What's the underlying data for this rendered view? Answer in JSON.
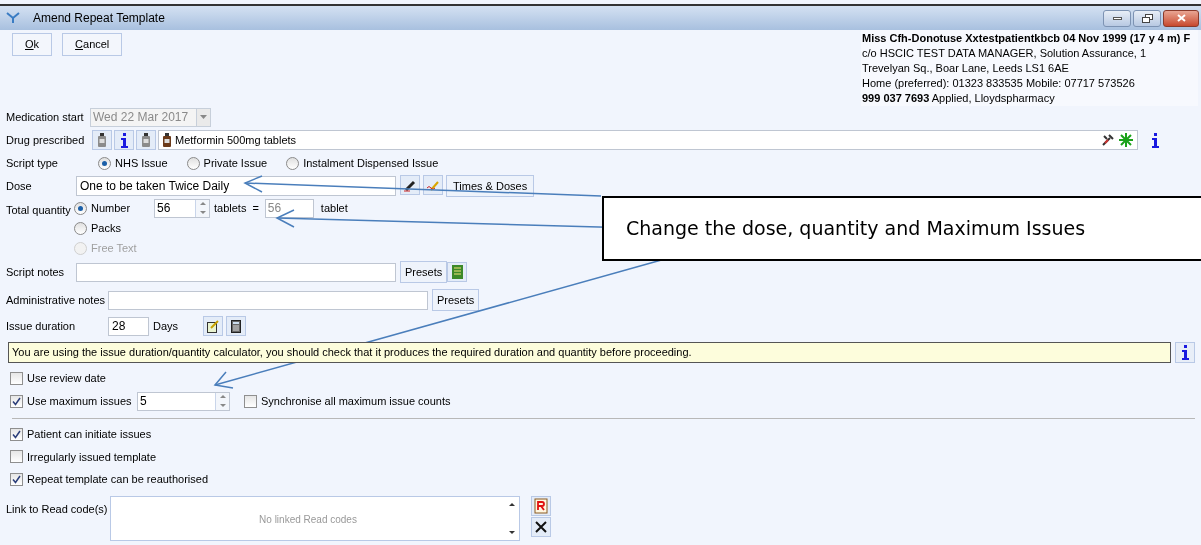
{
  "window": {
    "title": "Amend Repeat Template"
  },
  "toolbar": {
    "buttons": [
      "Ok",
      "Cancel"
    ]
  },
  "patient": {
    "name_line": "Miss Cfh-Donotuse Xxtestpatientkbcb 04 Nov 1999 (17 y  4 m) F",
    "address_lines": [
      "c/o HSCIC TEST DATA MANAGER, Solution Assurance, 1",
      "Trevelyan Sq., Boar Lane, Leeds LS1 6AE"
    ],
    "phone": "Home (preferred): 01323 833535 Mobile: 07717 573526",
    "identity": "**999 037 7693**  Applied, Lloydspharmacy"
  },
  "medication_start": {
    "label": "Medication start",
    "value": "Wed 22 Mar 2017",
    "disabled": true
  },
  "drug_prescribed": {
    "label": "Drug prescribed",
    "value": "Metformin 500mg tablets"
  },
  "script_type": {
    "label": "Script type",
    "options": [
      {
        "label": "NHS Issue",
        "selected": true
      },
      {
        "label": "Private Issue",
        "selected": false
      },
      {
        "label": "Instalment Dispensed Issue",
        "selected": false
      }
    ]
  },
  "dose": {
    "label": "Dose",
    "value": "One to be taken Twice Daily",
    "button": "Times & Doses"
  },
  "total_quantity": {
    "label": "Total quantity",
    "options": [
      {
        "label": "Number",
        "selected": true,
        "disabled": false
      },
      {
        "label": "Packs",
        "selected": false,
        "disabled": false
      },
      {
        "label": "Free Text",
        "selected": false,
        "disabled": true
      }
    ],
    "quantity": "56",
    "unit": "tablets",
    "equals": "=",
    "converted": "56",
    "converted_unit": "tablet"
  },
  "script_notes": {
    "label": "Script notes",
    "button": "Presets"
  },
  "administrative_notes": {
    "label": "Administrative notes",
    "button": "Presets"
  },
  "issue_duration": {
    "label": "Issue duration",
    "value": "28",
    "unit": "Days"
  },
  "info_message": "You are using the issue duration/quantity calculator, you should check that it produces the required duration and quantity before proceeding.",
  "review_date": {
    "label": "Use review date",
    "checked": false
  },
  "maximum_issues": {
    "label": "Use maximum issues",
    "checked": true,
    "value": "5",
    "synchronise": {
      "label": "Synchronise all maximum issue counts",
      "checked": false
    }
  },
  "options": [
    {
      "label": "Patient can initiate issues",
      "checked": true
    },
    {
      "label": "Irregularly issued template",
      "checked": false
    },
    {
      "label": "Repeat template can be reauthorised",
      "checked": true
    }
  ],
  "read_codes": {
    "label": "Link to Read code(s)",
    "empty_text": "No linked Read codes"
  },
  "callout": {
    "text": "Change the dose, quantity and Maximum Issues"
  }
}
